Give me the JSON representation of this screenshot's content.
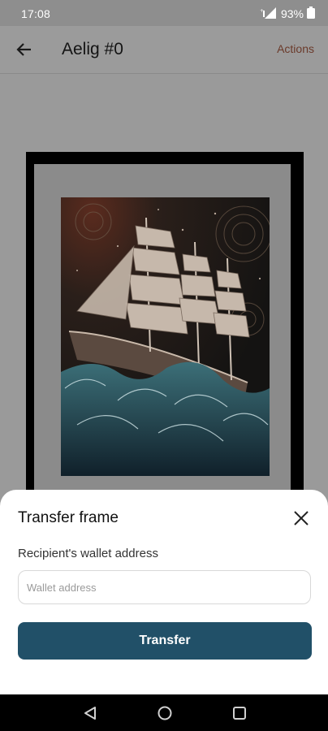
{
  "status_bar": {
    "time": "17:08",
    "battery": "93%",
    "icons": [
      "data-signal-icon",
      "battery-icon"
    ]
  },
  "app_bar": {
    "title": "Aelig #0",
    "actions_label": "Actions",
    "back_icon": "arrow-left-icon"
  },
  "artwork": {
    "subject": "ship-painting",
    "frame_color": "#000000",
    "mat_color": "#8b8b8b"
  },
  "sheet": {
    "title": "Transfer frame",
    "close_icon": "close-icon",
    "field_label": "Recipient's wallet address",
    "input_value": "",
    "input_placeholder": "Wallet address",
    "button_label": "Transfer",
    "button_color": "#215068"
  },
  "nav_bar": {
    "icons": [
      "back-triangle-icon",
      "home-circle-icon",
      "recents-square-icon"
    ]
  }
}
